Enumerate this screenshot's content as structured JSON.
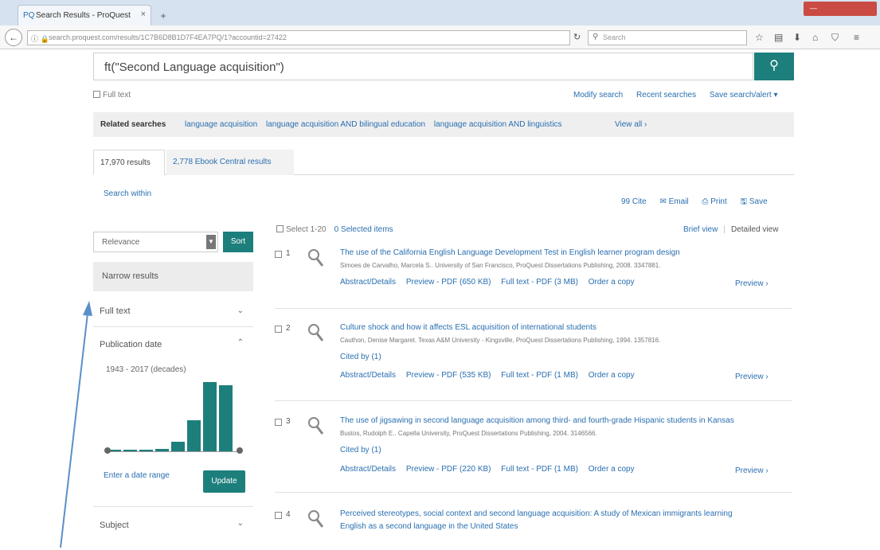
{
  "browser": {
    "tab_title": "Search Results - ProQuest",
    "tab_close": "×",
    "new_tab": "+",
    "url": "search.proquest.com/results/1C7B6D8B1D7F4EA7PQ/1?accountid=27422",
    "search_placeholder": "Search",
    "reload": "↻",
    "win_min": "—",
    "icons": [
      "star-icon",
      "bookmarks-icon",
      "download-icon",
      "home-icon",
      "pocket-icon",
      "menu-icon"
    ]
  },
  "search": {
    "query": "ft(\"Second Language acquisition\")",
    "fulltext_label": "Full text",
    "modify": "Modify search",
    "recent": "Recent searches",
    "save_search": "Save search/alert ▾"
  },
  "related": {
    "label": "Related searches",
    "links": [
      "language acquisition",
      "language acquisition AND bilingual education",
      "language acquisition AND linguistics"
    ],
    "view_all": "View all ›"
  },
  "tabs": {
    "results": "17,970 results",
    "ebook": "2,778 Ebook Central results"
  },
  "search_within": "Search within",
  "actions": {
    "cite": "99 Cite",
    "email": "✉ Email",
    "print": "⎙ Print",
    "save": "🖫 Save"
  },
  "sidebar": {
    "sort_value": "Relevance",
    "sort_button": "Sort",
    "narrow_title": "Narrow results",
    "facets": {
      "fulltext": "Full text",
      "pubdate": "Publication date",
      "subject": "Subject"
    },
    "date_range_label": "1943 - 2017 (decades)",
    "histogram": [
      0.03,
      0.03,
      0.03,
      0.04,
      0.15,
      0.45,
      1.0,
      0.96
    ],
    "enter_range": "Enter a date range",
    "update": "Update"
  },
  "results_header": {
    "select": "Select 1-20",
    "selected": "0 Selected items",
    "brief": "Brief view",
    "detailed": "Detailed view"
  },
  "results": [
    {
      "num": "1",
      "title": "The use of the California English Language Development Test in English learner program design",
      "citation": "Simoes de Carvalho, Marcela S.. University of San Francisco, ProQuest Dissertations Publishing, 2008. 3347881.",
      "cited": "",
      "links": [
        "Abstract/Details",
        "Preview - PDF (650 KB)",
        "Full text - PDF (3 MB)",
        "Order a copy"
      ],
      "preview": "Preview ›"
    },
    {
      "num": "2",
      "title": "Culture shock and how it affects ESL acquisition of international students",
      "citation": "Cauthon, Denise Margaret. Texas A&M University - Kingsville, ProQuest Dissertations Publishing, 1994. 1357816.",
      "cited": "Cited by (1)",
      "links": [
        "Abstract/Details",
        "Preview - PDF (535 KB)",
        "Full text - PDF (1 MB)",
        "Order a copy"
      ],
      "preview": "Preview ›"
    },
    {
      "num": "3",
      "title": "The use of jigsawing in second language acquisition among third- and fourth-grade Hispanic students in Kansas",
      "citation": "Bustos, Rudolph E.. Capella University, ProQuest Dissertations Publishing, 2004. 3146566.",
      "cited": "Cited by (1)",
      "links": [
        "Abstract/Details",
        "Preview - PDF (220 KB)",
        "Full text - PDF (1 MB)",
        "Order a copy"
      ],
      "preview": "Preview ›"
    },
    {
      "num": "4",
      "title": "Perceived stereotypes, social context and second language acquisition: A study of Mexican immigrants learning",
      "title2": "English as a second language in the United States",
      "citation": "",
      "cited": "",
      "links": [],
      "preview": ""
    }
  ],
  "colors": {
    "accent": "#1d7f7c",
    "link": "#2a6fb0",
    "arrow": "#5b8fc9"
  }
}
